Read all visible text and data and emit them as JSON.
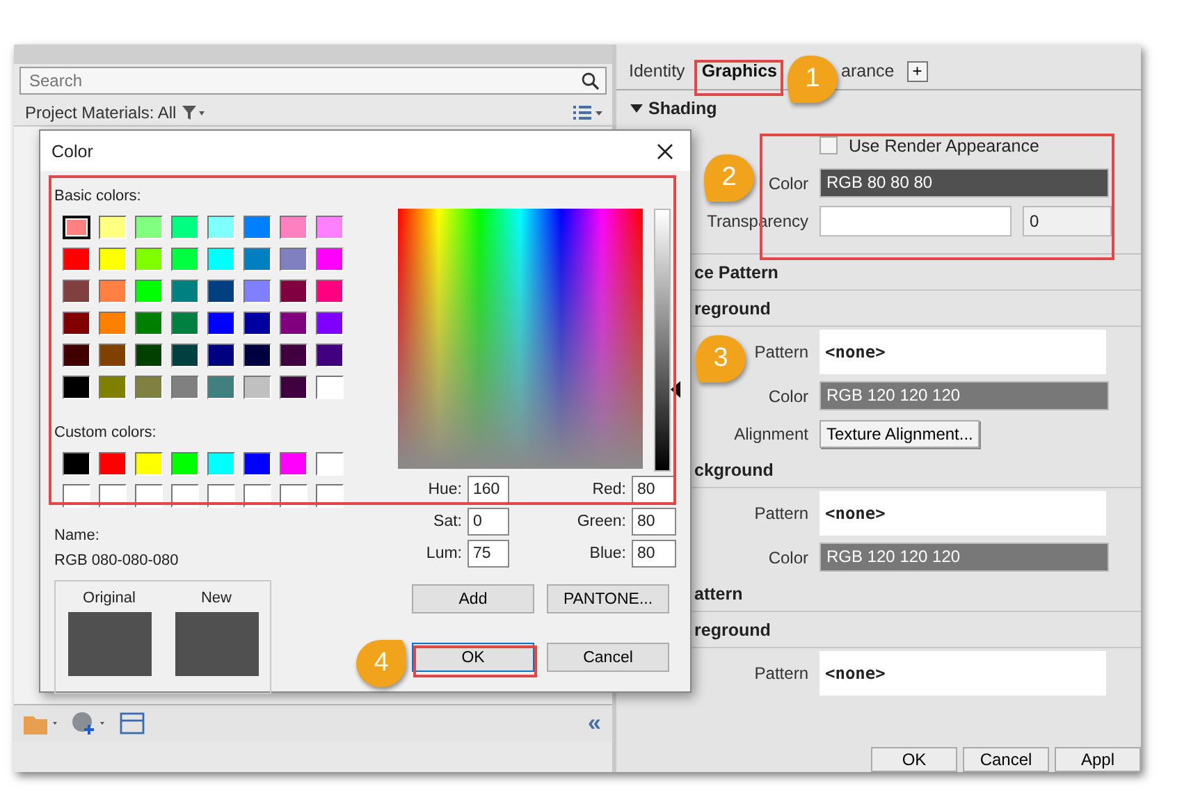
{
  "app": {
    "search": {
      "placeholder": "Search"
    },
    "materials_header": "Project Materials: All",
    "collapse_button": "«"
  },
  "properties": {
    "tabs": [
      {
        "label": "Identity",
        "selected": false
      },
      {
        "label": "Graphics",
        "selected": true
      },
      {
        "label": "arance",
        "selected": false
      }
    ],
    "add_tab": "+",
    "shading": {
      "title": "Shading",
      "expanded": true,
      "render": {
        "label": "Use Render Appearance",
        "checked": false
      },
      "color_label": "Color",
      "color_value": "RGB 80 80 80",
      "color": "#505050",
      "transparency_label": "Transparency",
      "transparency_value": "0"
    },
    "rows": [
      {
        "kind": "heading",
        "text": "ce Pattern"
      },
      {
        "kind": "heading",
        "text": "reground"
      },
      {
        "kind": "pattern",
        "label": "Pattern",
        "value": "<none>"
      },
      {
        "kind": "color",
        "label": "Color",
        "value": "RGB 120 120 120",
        "color": "#787878"
      },
      {
        "kind": "button",
        "label": "Alignment",
        "value": "Texture Alignment..."
      },
      {
        "kind": "heading",
        "text": "ckground"
      },
      {
        "kind": "pattern",
        "label": "Pattern",
        "value": "<none>"
      },
      {
        "kind": "color",
        "label": "Color",
        "value": "RGB 120 120 120",
        "color": "#787878"
      },
      {
        "kind": "heading",
        "text": "attern"
      },
      {
        "kind": "heading",
        "text": "reground"
      },
      {
        "kind": "pattern",
        "label": "Pattern",
        "value": "<none>"
      }
    ],
    "buttons": [
      "OK",
      "Cancel",
      "Appl"
    ]
  },
  "dialog": {
    "title": "Color",
    "basic_label": "Basic colors:",
    "basic_colors": [
      {
        "color": "#ff8080",
        "selected": true
      },
      {
        "color": "#ffff80",
        "selected": false
      },
      {
        "color": "#80ff80",
        "selected": false
      },
      {
        "color": "#00ff80",
        "selected": false
      },
      {
        "color": "#80ffff",
        "selected": false
      },
      {
        "color": "#0080ff",
        "selected": false
      },
      {
        "color": "#ff80c0",
        "selected": false
      },
      {
        "color": "#ff80ff",
        "selected": false
      },
      {
        "color": "#ff0000",
        "selected": false
      },
      {
        "color": "#ffff00",
        "selected": false
      },
      {
        "color": "#80ff00",
        "selected": false
      },
      {
        "color": "#00ff40",
        "selected": false
      },
      {
        "color": "#00ffff",
        "selected": false
      },
      {
        "color": "#0080c0",
        "selected": false
      },
      {
        "color": "#8080c0",
        "selected": false
      },
      {
        "color": "#ff00ff",
        "selected": false
      },
      {
        "color": "#804040",
        "selected": false
      },
      {
        "color": "#ff8040",
        "selected": false
      },
      {
        "color": "#00ff00",
        "selected": false
      },
      {
        "color": "#008080",
        "selected": false
      },
      {
        "color": "#004080",
        "selected": false
      },
      {
        "color": "#8080ff",
        "selected": false
      },
      {
        "color": "#800040",
        "selected": false
      },
      {
        "color": "#ff0080",
        "selected": false
      },
      {
        "color": "#800000",
        "selected": false
      },
      {
        "color": "#ff8000",
        "selected": false
      },
      {
        "color": "#008000",
        "selected": false
      },
      {
        "color": "#008040",
        "selected": false
      },
      {
        "color": "#0000ff",
        "selected": false
      },
      {
        "color": "#0000a0",
        "selected": false
      },
      {
        "color": "#800080",
        "selected": false
      },
      {
        "color": "#8000ff",
        "selected": false
      },
      {
        "color": "#400000",
        "selected": false
      },
      {
        "color": "#804000",
        "selected": false
      },
      {
        "color": "#004000",
        "selected": false
      },
      {
        "color": "#004040",
        "selected": false
      },
      {
        "color": "#000080",
        "selected": false
      },
      {
        "color": "#000040",
        "selected": false
      },
      {
        "color": "#400040",
        "selected": false
      },
      {
        "color": "#400080",
        "selected": false
      },
      {
        "color": "#000000",
        "selected": false
      },
      {
        "color": "#808000",
        "selected": false
      },
      {
        "color": "#808040",
        "selected": false
      },
      {
        "color": "#808080",
        "selected": false
      },
      {
        "color": "#408080",
        "selected": false
      },
      {
        "color": "#c0c0c0",
        "selected": false
      },
      {
        "color": "#400040",
        "selected": false
      },
      {
        "color": "#ffffff",
        "selected": false
      }
    ],
    "custom_label": "Custom colors:",
    "custom_colors": [
      {
        "color": "#000000"
      },
      {
        "color": "#ff0000"
      },
      {
        "color": "#ffff00"
      },
      {
        "color": "#00ff00"
      },
      {
        "color": "#00ffff"
      },
      {
        "color": "#0000ff"
      },
      {
        "color": "#ff00ff"
      },
      {
        "color": "#ffffff"
      },
      {
        "color": "#ffffff"
      },
      {
        "color": "#ffffff"
      },
      {
        "color": "#ffffff"
      },
      {
        "color": "#ffffff"
      },
      {
        "color": "#ffffff"
      },
      {
        "color": "#ffffff"
      },
      {
        "color": "#ffffff"
      },
      {
        "color": "#ffffff"
      }
    ],
    "luminance": {
      "level": 0.31
    },
    "fields": [
      {
        "label": "Hue:",
        "value": "160"
      },
      {
        "label": "Red:",
        "value": "80"
      },
      {
        "label": "Sat:",
        "value": "0"
      },
      {
        "label": "Green:",
        "value": "80"
      },
      {
        "label": "Lum:",
        "value": "75"
      },
      {
        "label": "Blue:",
        "value": "80"
      }
    ],
    "name_label": "Name:",
    "name_value": "RGB 080-080-080",
    "original_label": "Original",
    "new_label": "New",
    "add_button": "Add",
    "pantone_button": "PANTONE...",
    "ok_button": "OK",
    "cancel_button": "Cancel"
  },
  "callouts": [
    "1",
    "2",
    "3",
    "4"
  ]
}
